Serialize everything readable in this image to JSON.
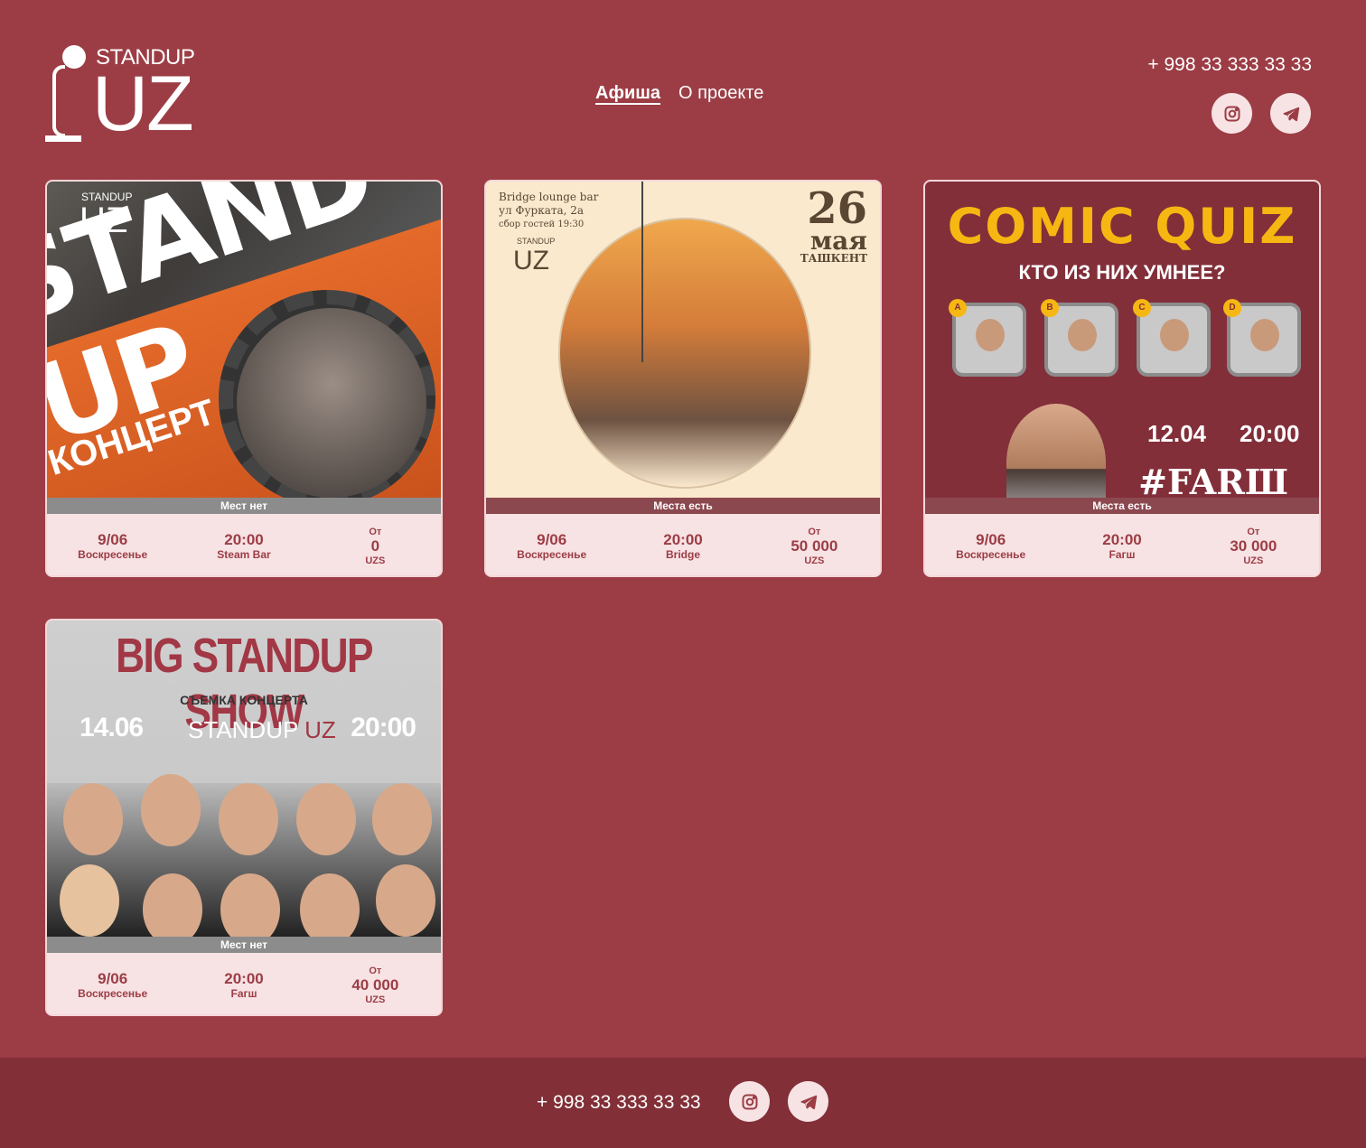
{
  "header": {
    "logo_top": "STANDUP",
    "logo_bottom": "UZ",
    "nav": [
      {
        "label": "Афиша",
        "active": true
      },
      {
        "label": "О проекте",
        "active": false
      }
    ],
    "phone": "+ 998 33 333 33 33",
    "social": [
      "instagram-icon",
      "telegram-icon"
    ]
  },
  "events": [
    {
      "poster": {
        "logo_top": "STANDUP",
        "logo_bottom": "UZ",
        "headline": "STAND UP",
        "subline": "КОНЦЕРТ"
      },
      "status": "Мест нет",
      "date": "9/06",
      "weekday": "Воскресенье",
      "time": "20:00",
      "venue": "Steam Bar",
      "price_prefix": "От",
      "price": "0",
      "currency": "UZS"
    },
    {
      "poster": {
        "venue_lines": [
          "Bridge lounge bar",
          "ул Фурката, 2а",
          "сбор гостей 19:30"
        ],
        "logo_top": "STANDUP",
        "logo_bottom": "UZ",
        "day": "26",
        "month": "мая",
        "city": "ТАШКЕНТ"
      },
      "status": "Места есть",
      "date": "9/06",
      "weekday": "Воскресенье",
      "time": "20:00",
      "venue": "Bridge",
      "price_prefix": "От",
      "price": "50 000",
      "currency": "UZS"
    },
    {
      "poster": {
        "headline": "COMIC QUIZ",
        "subline": "КТО ИЗ НИХ УМНЕЕ?",
        "badges": [
          "A",
          "B",
          "C",
          "D"
        ],
        "date": "12.04",
        "time": "20:00",
        "brand": "#FARШ"
      },
      "status": "Места есть",
      "date": "9/06",
      "weekday": "Воскресенье",
      "time": "20:00",
      "venue": "Fагш",
      "price_prefix": "От",
      "price": "30 000",
      "currency": "UZS"
    },
    {
      "poster": {
        "headline": "BIG STANDUP SHOW",
        "subline": "СЪЕМКА КОНЦЕРТА",
        "date": "14.06",
        "logo_top": "STANDUP",
        "logo_bottom": "UZ",
        "time": "20:00"
      },
      "status": "Мест нет",
      "date": "9/06",
      "weekday": "Воскресенье",
      "time": "20:00",
      "venue": "Fагш",
      "price_prefix": "От",
      "price": "40 000",
      "currency": "UZS"
    }
  ],
  "footer": {
    "phone": "+ 998 33 333 33 33",
    "social": [
      "instagram-icon",
      "telegram-icon"
    ]
  },
  "colors": {
    "background": "#9c3d45",
    "footer": "#822f38",
    "accent_light": "#f7e3e4",
    "text_accent": "#9c3d45"
  }
}
